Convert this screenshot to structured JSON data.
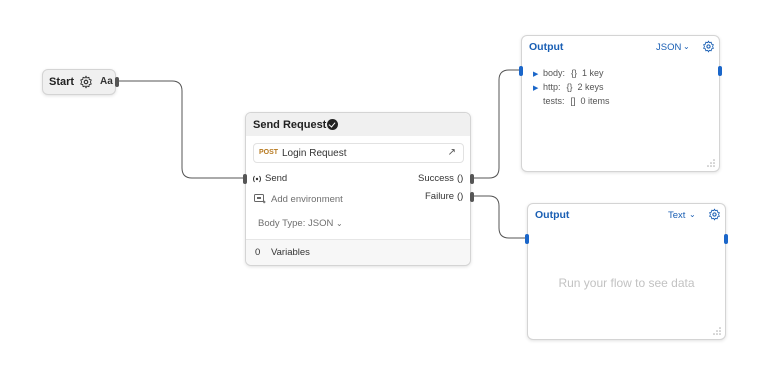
{
  "start_node": {
    "title": "Start",
    "icons": [
      "gear-icon"
    ],
    "type_badge": "Aa"
  },
  "send_request_node": {
    "title": "Send Request",
    "status_icon": "check-circle-icon",
    "request": {
      "method": "POST",
      "name": "Login Request",
      "open_icon": "external-arrow-icon"
    },
    "send_label": "Send",
    "send_icon": "signal-icon",
    "add_env_label": "Add environment",
    "add_env_icon": "environment-icon",
    "body_type_label": "Body Type: JSON",
    "success_label": "Success",
    "failure_label": "Failure",
    "paren": "()",
    "variables_count": "0",
    "variables_label": "Variables"
  },
  "output_nodes": [
    {
      "title": "Output",
      "format": "JSON",
      "rows": [
        {
          "expandable": true,
          "key": "body:",
          "type": "{}",
          "value": "1 key"
        },
        {
          "expandable": true,
          "key": "http:",
          "type": "{}",
          "value": "2 keys"
        },
        {
          "expandable": false,
          "key": "tests:",
          "type": "[]",
          "value": "0 items"
        }
      ]
    },
    {
      "title": "Output",
      "format": "Text",
      "placeholder": "Run your flow to see data"
    }
  ],
  "colors": {
    "accent": "#1a5fb4",
    "port_blue": "#1a66c9",
    "port_gray": "#555555",
    "method_post": "#b7791f",
    "wire": "#555555"
  }
}
